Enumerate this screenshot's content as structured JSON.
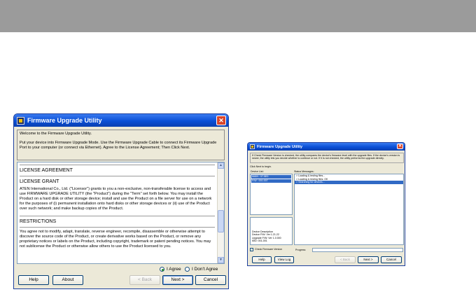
{
  "left_window": {
    "title": "Firmware Upgrade Utility",
    "welcome_heading": "Welcome to the Firmware Upgrade Utility.",
    "welcome_text": "Put your device into Firmware Upgrade Mode. Use the Firmware Upgrade Cable to connect its Firmware Upgrade Port to your computer (or connect via Ethernet). Agree to the License Agreement; Then Click Next.",
    "license_title": "LICENSE AGREEMENT",
    "license_grant_heading": "LICENSE GRANT",
    "license_grant_text": "ATEN International Co., Ltd. (\"Licensor\") grants to you a non-exclusive, non-transferable license to access and use FIRMWARE UPGRADE UTILITY (the \"Product\") during the \"Term\" set forth below. You may install the Product on a hard disk or other storage device; install and use the Product on a file server for use on a network for the purposes of (i) permanent installation onto hard disks or other storage devices or (ii) use of the Product over such network; and make backup copies of the Product.",
    "restrictions_heading": "RESTRICTIONS",
    "restrictions_text": "You agree not to modify, adapt, translate, reverse engineer, recompile, disassemble or otherwise attempt to discover the source code of the Product, or create derivative works based on the Product, or remove any proprietary notices or labels on the Product, including copyright, trademark or patent pending notices. You may not sublicense the Product or otherwise allow others to use the Product licensed to you.",
    "agree_label": "I Agree",
    "disagree_label": "I Don't Agree",
    "buttons": {
      "help": "Help",
      "about": "About",
      "back": "< Back",
      "next": "Next >",
      "cancel": "Cancel"
    }
  },
  "right_window": {
    "title": "Firmware Upgrade Utility",
    "info_text": "If Check Firmware Version is checked, the utility compares the device's firmware level with the upgrade files. If the device's version is newer, the utility lets you decide whether to continue or not. If it is not checked, the utility performs the upgrade directly.",
    "click_text": "Click Next to begin.",
    "device_list_label": "Device List:",
    "devices": [
      "MAIN : 07.5E0",
      "F/W : 001.007"
    ],
    "status_label": "Status Messages:",
    "status_messages": [
      "> Loading & testing files...",
      "> Loading & testing files: OK",
      "> Searching for devices..."
    ],
    "device_description_label": "Device Description",
    "device_description_lines": [
      "Device F/W: Ver 1.21.22",
      "Upgrade F/W: Ver 1.0.000",
      "MID: 001-001"
    ],
    "check_firmware_label": "Check Firmware Version",
    "progress_label": "Progress",
    "buttons": {
      "help": "Help",
      "view_log": "View Log",
      "back": "< Back",
      "next": "Next >",
      "cancel": "Cancel"
    }
  }
}
